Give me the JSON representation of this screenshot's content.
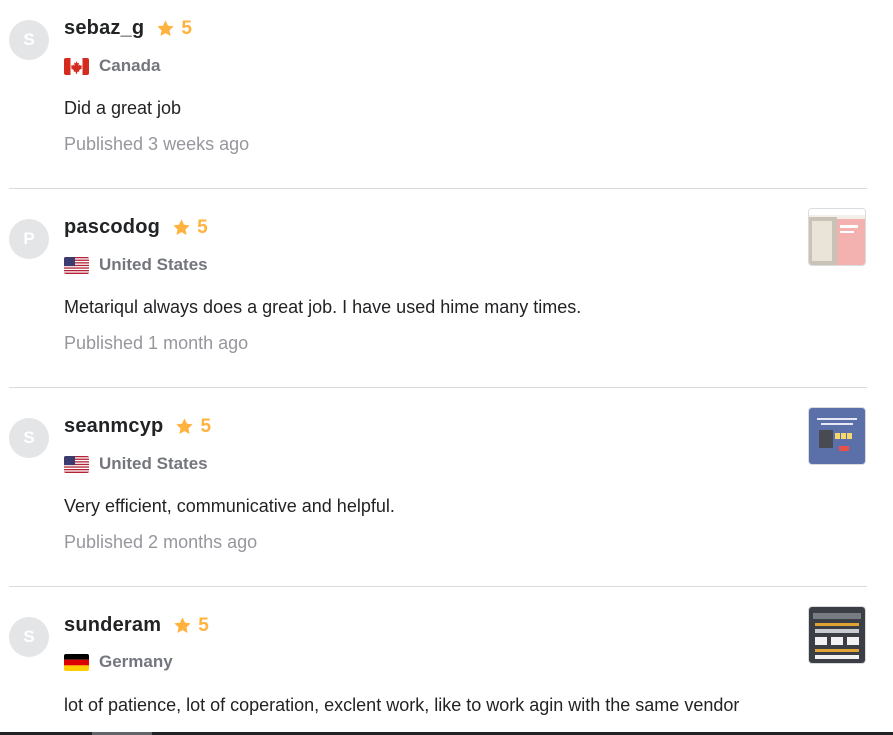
{
  "reviews": [
    {
      "initial": "S",
      "username": "sebaz_g",
      "rating": "5",
      "country": "Canada",
      "flag": "canada-flag-icon",
      "text": "Did a great job",
      "published": "Published 3 weeks ago",
      "has_thumbnail": false
    },
    {
      "initial": "P",
      "username": "pascodog",
      "rating": "5",
      "country": "United States",
      "flag": "united-states-flag-icon",
      "text": "Metariqul always does a great job. I have used hime many times.",
      "published": "Published 1 month ago",
      "has_thumbnail": true
    },
    {
      "initial": "S",
      "username": "seanmcyp",
      "rating": "5",
      "country": "United States",
      "flag": "united-states-flag-icon",
      "text": "Very efficient, communicative and helpful.",
      "published": "Published 2 months ago",
      "has_thumbnail": true
    },
    {
      "initial": "S",
      "username": "sunderam",
      "rating": "5",
      "country": "Germany",
      "flag": "germany-flag-icon",
      "text": "lot of patience, lot of coperation, exclent work, like to work agin with the same vendor",
      "published": "",
      "has_thumbnail": true
    }
  ],
  "colors": {
    "star": "#ffb33e",
    "username": "#222325",
    "muted": "#95979d",
    "divider": "#dadbdd"
  }
}
